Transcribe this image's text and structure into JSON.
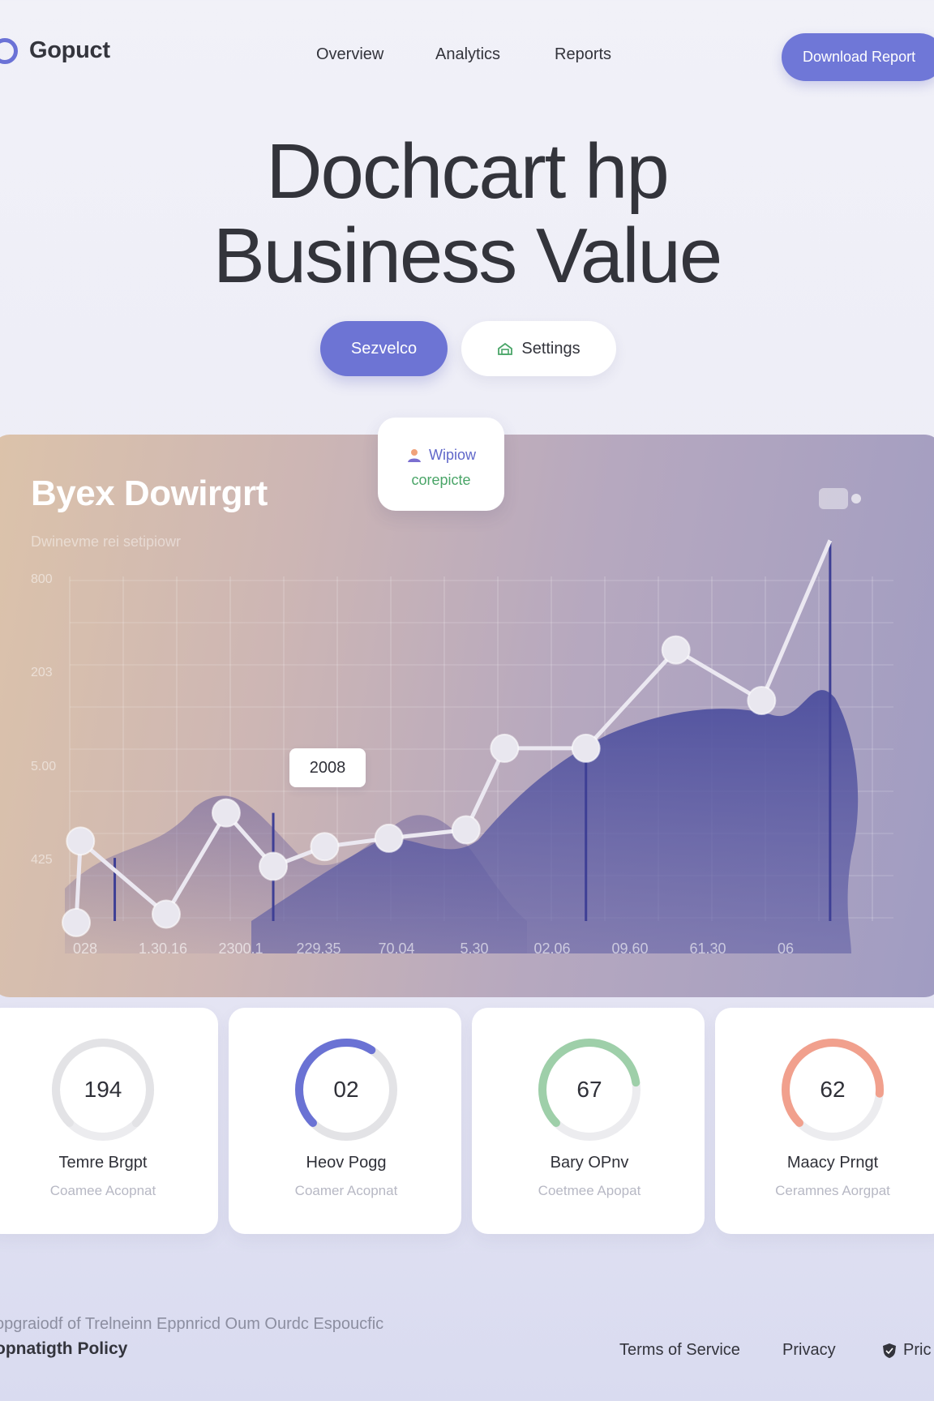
{
  "header": {
    "brand": "Gopuct",
    "nav": [
      "Overview",
      "Analytics",
      "Reports"
    ],
    "download_label": "Download Report"
  },
  "hero": {
    "title_line1": "Dochcart hp",
    "title_line2": "Business Value",
    "primary_button": "Sezvelco",
    "secondary_button": "Settings",
    "secondary_icon": "settings-icon"
  },
  "chart_card": {
    "title": "Byex Dowirgrt",
    "subtitle": "Dwinevme rei setipiowr",
    "tooltip_line1": "Wipiow",
    "tooltip_line2": "corepicte",
    "tooltip_icon": "person-icon",
    "callout": "2008"
  },
  "chart_data": {
    "type": "line",
    "title": "Byex Dowirgrt",
    "subtitle": "Dwinevme rei setipiowr",
    "y_tick_labels": [
      "800",
      "203",
      "5.00",
      "425"
    ],
    "x_tick_labels": [
      "028",
      "1.30.16",
      "2300.1",
      "229.35",
      "70.04",
      "5.30",
      "02.06",
      "09.60",
      "61.30",
      "06"
    ],
    "series": [
      {
        "values": [
          {
            "x": 0.0,
            "y": 305
          },
          {
            "x": 0.05,
            "y": 450
          },
          {
            "x": 1.05,
            "y": 320
          },
          {
            "x": 1.75,
            "y": 500
          },
          {
            "x": 2.3,
            "y": 405
          },
          {
            "x": 2.9,
            "y": 440
          },
          {
            "x": 3.65,
            "y": 455
          },
          {
            "x": 4.55,
            "y": 470
          },
          {
            "x": 5.0,
            "y": 615
          },
          {
            "x": 5.95,
            "y": 615
          },
          {
            "x": 7.0,
            "y": 790
          },
          {
            "x": 8.0,
            "y": 700
          },
          {
            "x": 8.8,
            "y": 985
          }
        ]
      }
    ],
    "grid": true,
    "area_fill": true,
    "colors": {
      "line": "#e8e6ef",
      "area": "#4a4c9a",
      "stems": "#3e3f95"
    }
  },
  "stats": [
    {
      "value": "194",
      "label": "Temre Brgpt",
      "sub": "Coamee Acopnat",
      "color": "#e3e3e6",
      "progress": 1.0
    },
    {
      "value": "02",
      "label": "Heov Pogg",
      "sub": "Coamer Acopnat",
      "color": "#6a72d4",
      "progress": 0.62
    },
    {
      "value": "67",
      "label": "Bary OPnv",
      "sub": "Coetmee Apopat",
      "color": "#9ecfa9",
      "progress": 0.8
    },
    {
      "value": "62",
      "label": "Maacy Prngt",
      "sub": "Ceramnes Aorgpat",
      "color": "#f1a08d",
      "progress": 0.85
    }
  ],
  "footer": {
    "description": "opgraiodf of Trelneinn Eppnricd Oum Ourdc Espoucfic",
    "policy": "opnatigth Policy",
    "links": [
      "Terms of Service",
      "Privacy",
      "Pric"
    ]
  }
}
